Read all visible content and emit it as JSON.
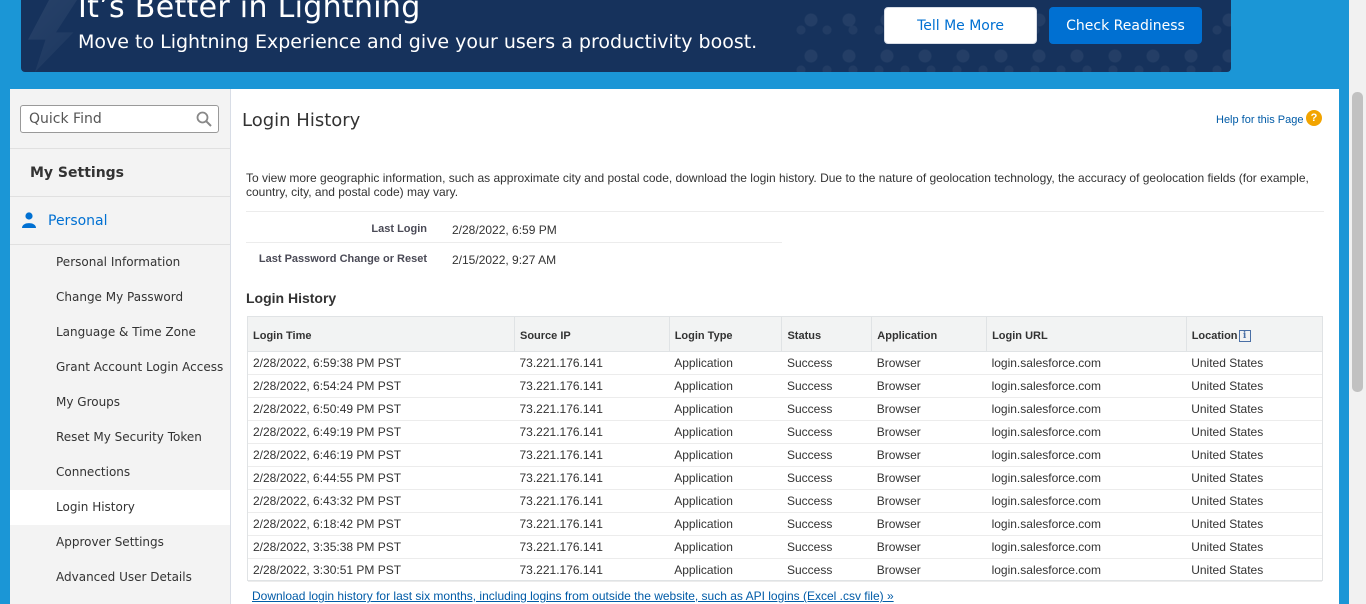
{
  "banner": {
    "title": "It’s Better in Lightning",
    "subtitle": "Move to Lightning Experience and give your users a productivity boost.",
    "tell_me_more": "Tell Me More",
    "check_readiness": "Check Readiness"
  },
  "sidebar": {
    "quick_find_placeholder": "Quick Find",
    "section_title": "My Settings",
    "group_label": "Personal",
    "items": [
      {
        "label": "Personal Information"
      },
      {
        "label": "Change My Password"
      },
      {
        "label": "Language & Time Zone"
      },
      {
        "label": "Grant Account Login Access"
      },
      {
        "label": "My Groups"
      },
      {
        "label": "Reset My Security Token"
      },
      {
        "label": "Connections"
      },
      {
        "label": "Login History"
      },
      {
        "label": "Approver Settings"
      },
      {
        "label": "Advanced User Details"
      }
    ]
  },
  "page": {
    "title": "Login History",
    "help": "Help for this Page",
    "intro": "To view more geographic information, such as approximate city and postal code, download the login history. Due to the nature of geolocation technology, the accuracy of geolocation fields (for example, country, city, and postal code) may vary.",
    "last_login_label": "Last Login",
    "last_login_value": "2/28/2022, 6:59 PM",
    "last_pw_label": "Last Password Change or Reset",
    "last_pw_value": "2/15/2022, 9:27 AM",
    "section_title": "Login History",
    "download_link": "Download login history for last six months, including logins from outside the website, such as API logins (Excel .csv file) »"
  },
  "table": {
    "columns": [
      "Login Time",
      "Source IP",
      "Login Type",
      "Status",
      "Application",
      "Login URL",
      "Location"
    ],
    "rows": [
      [
        "2/28/2022, 6:59:38 PM PST",
        "73.221.176.141",
        "Application",
        "Success",
        "Browser",
        "login.salesforce.com",
        "United States"
      ],
      [
        "2/28/2022, 6:54:24 PM PST",
        "73.221.176.141",
        "Application",
        "Success",
        "Browser",
        "login.salesforce.com",
        "United States"
      ],
      [
        "2/28/2022, 6:50:49 PM PST",
        "73.221.176.141",
        "Application",
        "Success",
        "Browser",
        "login.salesforce.com",
        "United States"
      ],
      [
        "2/28/2022, 6:49:19 PM PST",
        "73.221.176.141",
        "Application",
        "Success",
        "Browser",
        "login.salesforce.com",
        "United States"
      ],
      [
        "2/28/2022, 6:46:19 PM PST",
        "73.221.176.141",
        "Application",
        "Success",
        "Browser",
        "login.salesforce.com",
        "United States"
      ],
      [
        "2/28/2022, 6:44:55 PM PST",
        "73.221.176.141",
        "Application",
        "Success",
        "Browser",
        "login.salesforce.com",
        "United States"
      ],
      [
        "2/28/2022, 6:43:32 PM PST",
        "73.221.176.141",
        "Application",
        "Success",
        "Browser",
        "login.salesforce.com",
        "United States"
      ],
      [
        "2/28/2022, 6:18:42 PM PST",
        "73.221.176.141",
        "Application",
        "Success",
        "Browser",
        "login.salesforce.com",
        "United States"
      ],
      [
        "2/28/2022, 3:35:38 PM PST",
        "73.221.176.141",
        "Application",
        "Success",
        "Browser",
        "login.salesforce.com",
        "United States"
      ],
      [
        "2/28/2022, 3:30:51 PM PST",
        "73.221.176.141",
        "Application",
        "Success",
        "Browser",
        "login.salesforce.com",
        "United States"
      ]
    ]
  },
  "icons": {
    "search": "search-icon",
    "person": "person-icon",
    "help": "help-icon",
    "info": "info-icon"
  }
}
